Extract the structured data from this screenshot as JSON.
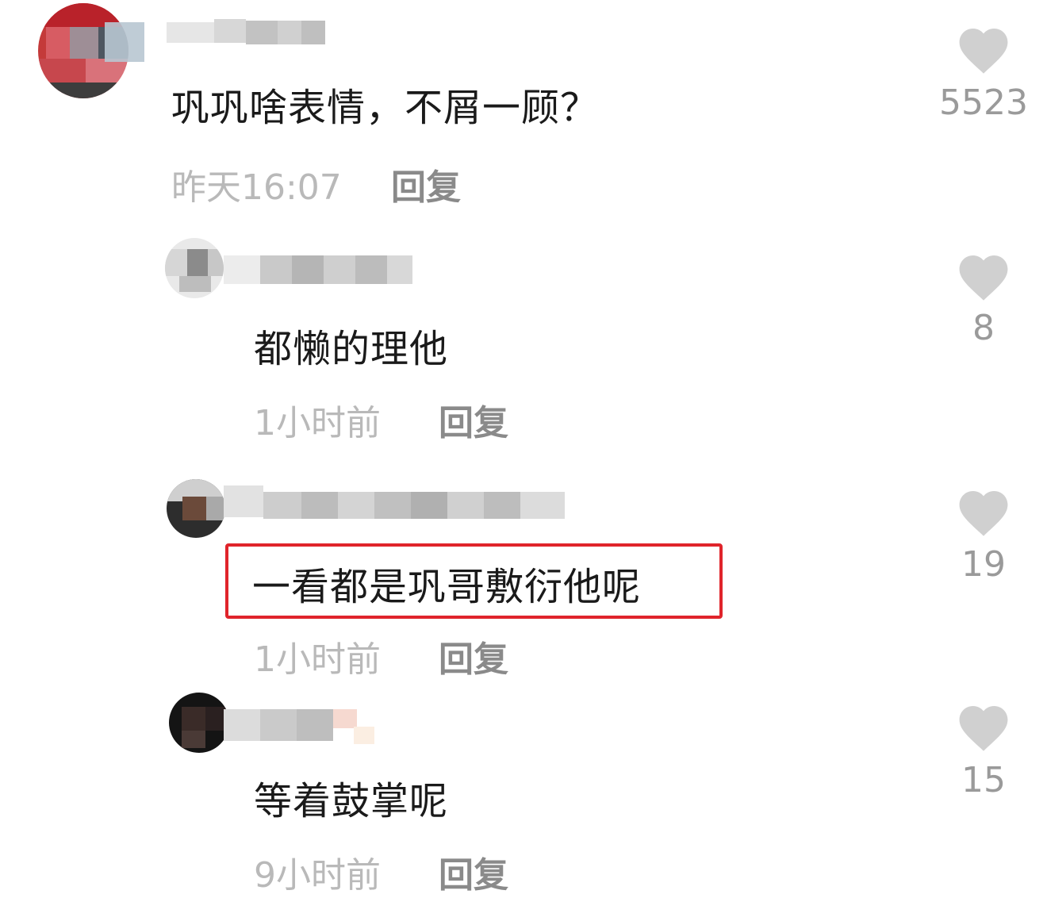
{
  "comments": [
    {
      "text": "巩巩啥表情，不屑一顾？",
      "time": "昨天16:07",
      "reply_label": "回复",
      "likes": "5523"
    },
    {
      "text": "都懒的理他",
      "time": "1小时前",
      "reply_label": "回复",
      "likes": "8"
    },
    {
      "text": "一看都是巩哥敷衍他呢",
      "time": "1小时前",
      "reply_label": "回复",
      "likes": "19"
    },
    {
      "text": "等着鼓掌呢",
      "time": "9小时前",
      "reply_label": "回复",
      "likes": "15"
    }
  ],
  "icons": {
    "like": "heart-icon",
    "avatar": "avatar"
  },
  "colors": {
    "highlight": "#e0242b",
    "heart": "#d0d0d0",
    "time": "#b9b9b9",
    "reply": "#8a8a8a",
    "like_count": "#9a9a9a"
  }
}
